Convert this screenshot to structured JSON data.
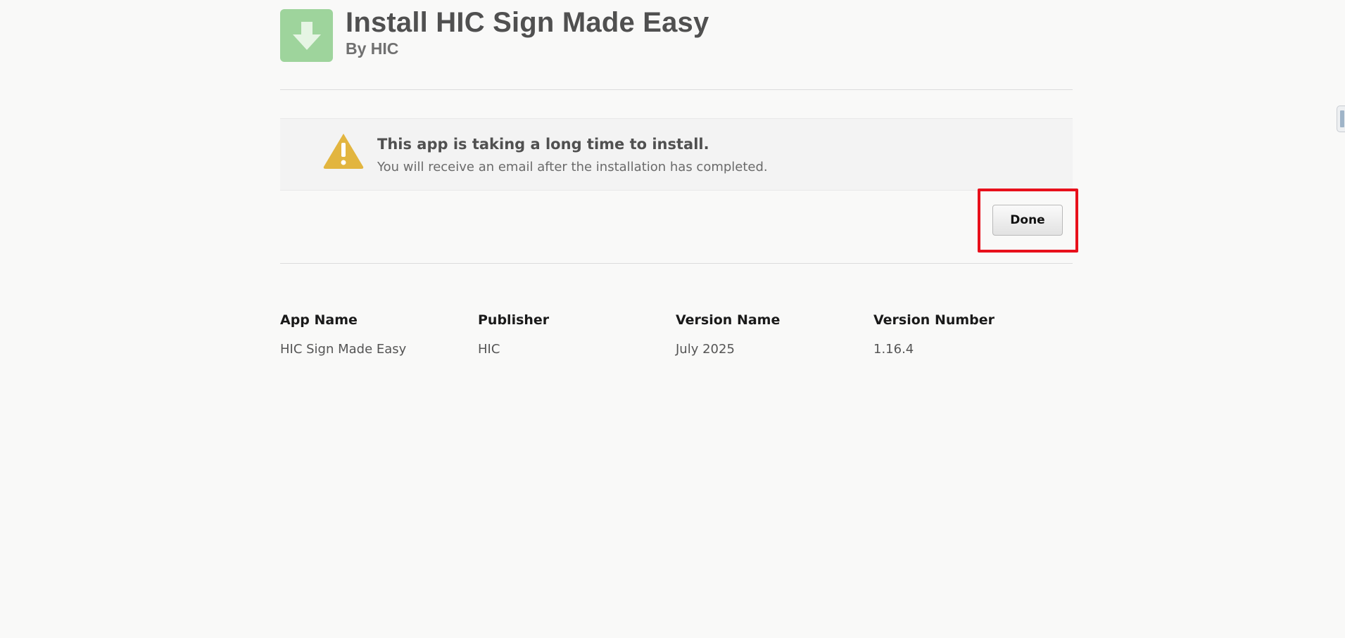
{
  "header": {
    "title": "Install HIC Sign Made Easy",
    "subtitle": "By HIC",
    "icon": "download-arrow-icon",
    "icon_color": "#9ed49c"
  },
  "notice": {
    "icon": "warning-icon",
    "icon_color": "#e2b53f",
    "title": "This app is taking a long time to install.",
    "message": "You will receive an email after the installation has completed."
  },
  "actions": {
    "done_label": "Done",
    "highlight_color": "#e8101b"
  },
  "details": {
    "columns": [
      {
        "header": "App Name",
        "value": "HIC Sign Made Easy"
      },
      {
        "header": "Publisher",
        "value": "HIC"
      },
      {
        "header": "Version Name",
        "value": "July 2025"
      },
      {
        "header": "Version Number",
        "value": "1.16.4"
      }
    ]
  }
}
